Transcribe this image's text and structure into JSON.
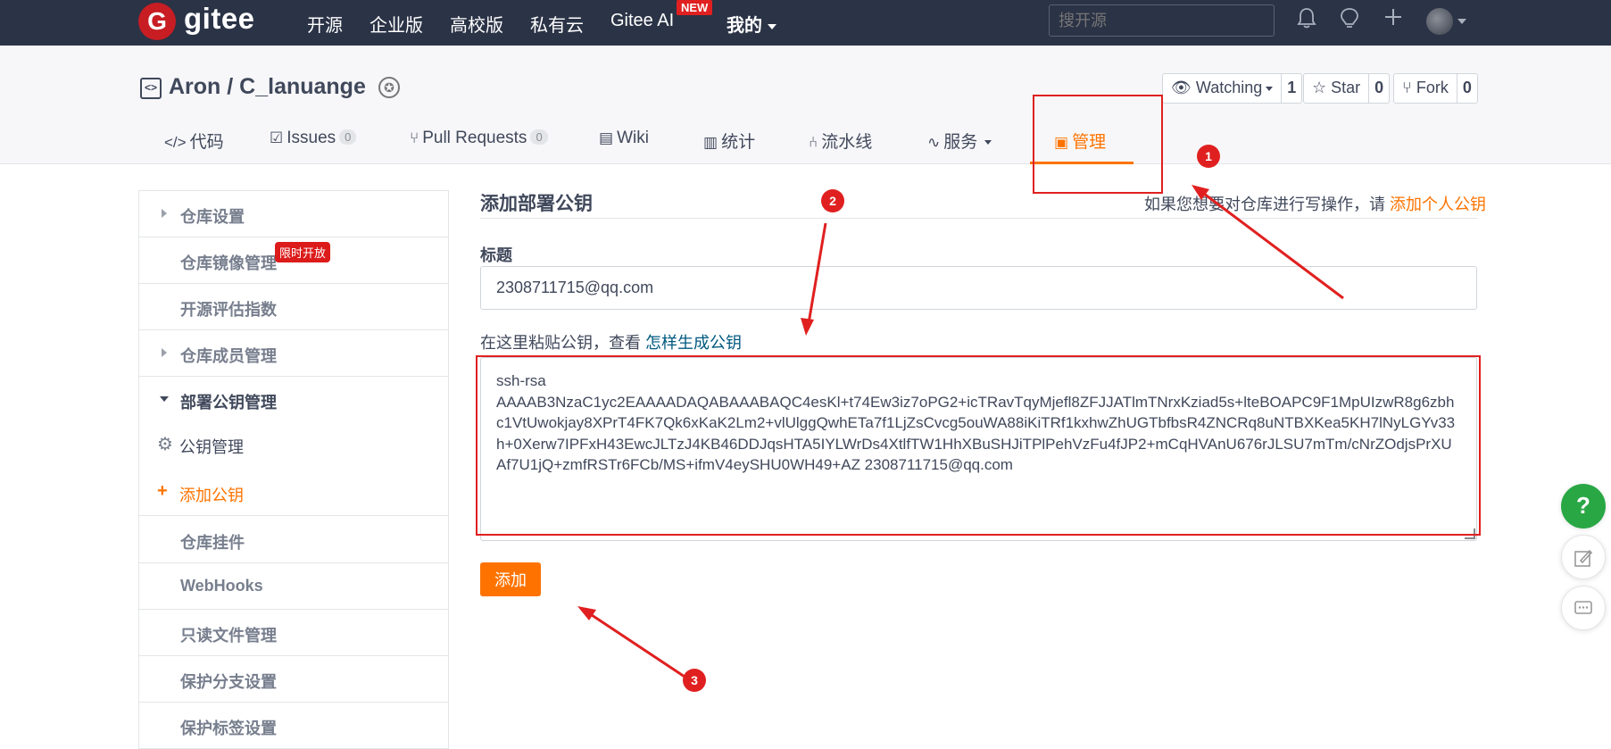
{
  "topnav": {
    "logo_letter": "G",
    "logo_text": "gitee",
    "items": [
      "开源",
      "企业版",
      "高校版",
      "私有云",
      "Gitee AI",
      "我的"
    ],
    "new_badge": "NEW",
    "search_placeholder": "搜开源",
    "icons": [
      "bell-icon",
      "lightbulb-icon",
      "plus-icon"
    ]
  },
  "project": {
    "title": "Aron / C_lanuange",
    "watching_label": "Watching",
    "watching_count": "1",
    "star_label": "Star",
    "star_count": "0",
    "fork_label": "Fork",
    "fork_count": "0"
  },
  "tabs": [
    {
      "icon": "</>",
      "label": "代码"
    },
    {
      "icon": "☑",
      "label": "Issues",
      "count": "0"
    },
    {
      "icon": "⑂",
      "label": "Pull Requests",
      "count": "0"
    },
    {
      "icon": "▤",
      "label": "Wiki"
    },
    {
      "icon": "▥",
      "label": "统计"
    },
    {
      "icon": "⑃",
      "label": "流水线"
    },
    {
      "icon": "∿",
      "label": "服务"
    },
    {
      "icon": "▣",
      "label": "管理"
    }
  ],
  "sidebar": {
    "items": [
      {
        "label": "仓库设置"
      },
      {
        "label": "仓库镜像管理",
        "badge": "限时开放"
      },
      {
        "label": "开源评估指数"
      },
      {
        "label": "仓库成员管理"
      },
      {
        "label": "部署公钥管理"
      },
      {
        "label": "公钥管理"
      },
      {
        "label": "添加公钥"
      },
      {
        "label": "仓库挂件"
      },
      {
        "label": "WebHooks"
      },
      {
        "label": "只读文件管理"
      },
      {
        "label": "保护分支设置"
      },
      {
        "label": "保护标签设置"
      }
    ]
  },
  "main": {
    "title": "添加部署公钥",
    "hint_prefix": "如果您想要对仓库进行写操作，请",
    "hint_link": "添加个人公钥",
    "title_label": "标题",
    "title_value": "2308711715@qq.com",
    "paste_label": "在这里粘贴公钥，查看",
    "paste_link": "怎样生成公钥",
    "key_value": "ssh-rsa\nAAAAB3NzaC1yc2EAAAADAQABAAABAQC4esKl+t74Ew3iz7oPG2+icTRavTqyMjefl8ZFJJATlmTNrxKziad5s+lteBOAPC9F1MpUIzwR8g6zbhc1VtUwokjay8XPrT4FK7Qk6xKaK2Lm2+vlUlggQwhETa7f1LjZsCvcg5ouWA88iKiTRf1kxhwZhUGTbfbsR4ZNCRq8uNTBXKea5KH7lNyLGYv33h+0Xerw7IPFxH43EwcJLTzJ4KB46DDJqsHTA5IYLWrDs4XtlfTW1HhXBuSHJiTPlPehVzFu4fJP2+mCqHVAnU676rJLSU7mTm/cNrZOdjsPrXUAf7U1jQ+zmfRSTr6FCb/MS+ifmV4eySHU0WH49+AZ 2308711715@qq.com",
    "add_button": "添加"
  },
  "annotations": [
    "1",
    "2",
    "3"
  ],
  "floating": {
    "help": "?"
  },
  "colors": {
    "accent": "#fe7300",
    "nav_bg": "#2b3346",
    "annotation": "#e02020",
    "help": "#29a745"
  }
}
